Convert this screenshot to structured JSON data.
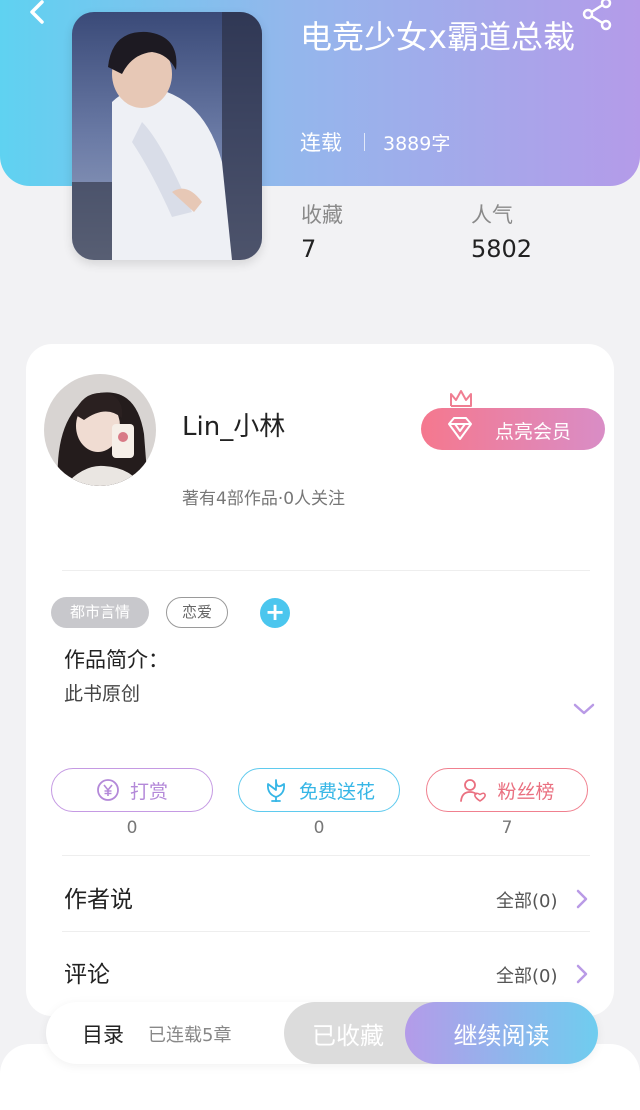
{
  "colors": {
    "hero_gradient_start": "#5fd2f1",
    "hero_gradient_end": "#b49be9",
    "accent_blue": "#4bc6ee",
    "accent_purple": "#b489d9",
    "accent_pink": "#ea7080"
  },
  "header": {
    "back_icon": "chevron-left-icon",
    "share_icon": "share-icon"
  },
  "book": {
    "title": "电竞少女x霸道总裁",
    "status": "连载",
    "word_count": "3889字",
    "stats": [
      {
        "label": "收藏",
        "value": "7"
      },
      {
        "label": "人气",
        "value": "5802"
      }
    ]
  },
  "author": {
    "name": "Lin_小林",
    "stats": "著有4部作品·0人关注",
    "vip_button": "点亮会员"
  },
  "tags": [
    "都市言情",
    "恋爱"
  ],
  "intro": {
    "heading": "作品简介：",
    "text": "此书原创"
  },
  "actions": [
    {
      "label": "打赏",
      "count": "0",
      "icon": "yen-coin-icon"
    },
    {
      "label": "免费送花",
      "count": "0",
      "icon": "flower-icon"
    },
    {
      "label": "粉丝榜",
      "count": "7",
      "icon": "fan-user-icon"
    }
  ],
  "sections": [
    {
      "label": "作者说",
      "link": "全部(0)"
    },
    {
      "label": "评论",
      "link": "全部(0)"
    }
  ],
  "bottom_bar": {
    "toc_label": "目录",
    "toc_count": "已连载5章",
    "favorite": "已收藏",
    "read": "继续阅读"
  }
}
